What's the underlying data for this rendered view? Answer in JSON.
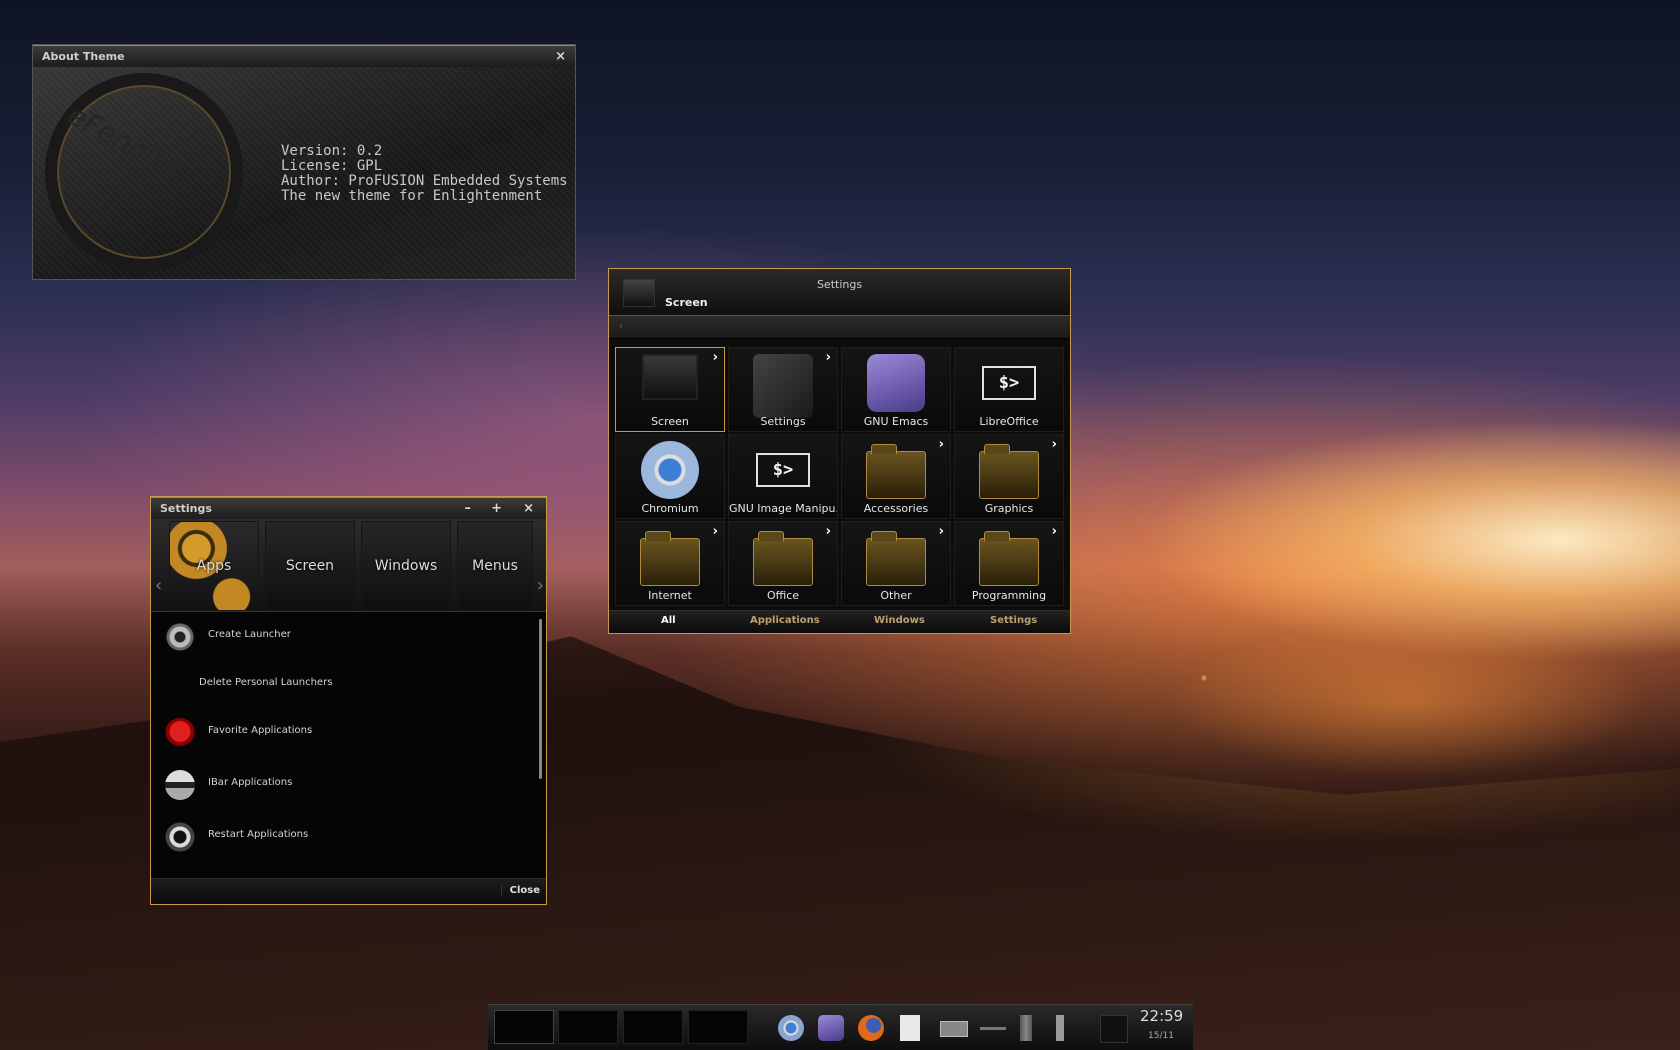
{
  "about": {
    "title": "About Theme",
    "close_glyph": "×",
    "logo_text": "eFenniht",
    "info_lines": [
      "Version: 0.2",
      "License: GPL",
      "Author: ProFUSION Embedded Systems",
      "The new theme for Enlightenment"
    ]
  },
  "grid": {
    "title": "Settings",
    "selected": "Screen",
    "path_glyph": "›",
    "cells": [
      {
        "label": "Screen",
        "icon": "monitor-icon",
        "arrow": true
      },
      {
        "label": "Settings",
        "icon": "wrench-icon",
        "arrow": true
      },
      {
        "label": "GNU Emacs",
        "icon": "emacs-icon",
        "arrow": false
      },
      {
        "label": "LibreOffice",
        "icon": "terminal-icon",
        "arrow": false
      },
      {
        "label": "Chromium",
        "icon": "chromium-icon",
        "arrow": false
      },
      {
        "label": "GNU Image Manipu...",
        "icon": "terminal-icon",
        "arrow": false
      },
      {
        "label": "Accessories",
        "icon": "folder-icon",
        "arrow": true
      },
      {
        "label": "Graphics",
        "icon": "folder-icon",
        "arrow": true
      },
      {
        "label": "Internet",
        "icon": "folder-icon",
        "arrow": true
      },
      {
        "label": "Office",
        "icon": "folder-icon",
        "arrow": true
      },
      {
        "label": "Other",
        "icon": "folder-icon",
        "arrow": true
      },
      {
        "label": "Programming",
        "icon": "folder-icon",
        "arrow": true
      }
    ],
    "term_glyph": "$>",
    "arrow_glyph": "›",
    "tabs": [
      "All",
      "Applications",
      "Windows",
      "Settings"
    ]
  },
  "panel": {
    "title": "Settings",
    "buttons": {
      "minimize": "–",
      "maximize": "+",
      "close": "×"
    },
    "nav_prev": "‹",
    "nav_next": "›",
    "toolbar": [
      "Apps",
      "Screen",
      "Windows",
      "Menus"
    ],
    "items": [
      {
        "label": "Create Launcher",
        "icon": "gear-icon"
      },
      {
        "label": "Delete Personal Launchers",
        "icon": ""
      },
      {
        "label": "Favorite Applications",
        "icon": "heart-icon"
      },
      {
        "label": "IBar Applications",
        "icon": "ibar-icon"
      },
      {
        "label": "Restart Applications",
        "icon": "restart-icon"
      }
    ],
    "close_label": "Close"
  },
  "taskbar": {
    "clock": "22:59",
    "date": "15/11",
    "tray_icons": [
      "chromium-icon",
      "emacs-icon",
      "firefox-icon",
      "document-icon",
      "battery-icon",
      "network-icon",
      "bluetooth-icon",
      "volume-icon",
      "dropbox-icon"
    ]
  },
  "colors": {
    "accent": "#c89a46"
  }
}
